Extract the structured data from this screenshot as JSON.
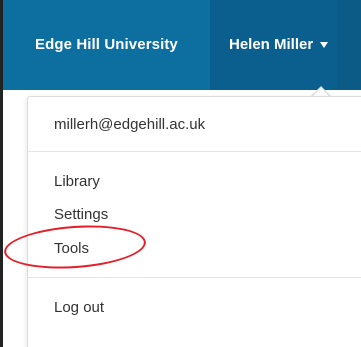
{
  "header": {
    "brand": "Edge Hill University",
    "user_name": "Helen Miller"
  },
  "menu": {
    "email": "millerh@edgehill.ac.uk",
    "items": [
      {
        "label": "Library"
      },
      {
        "label": "Settings"
      },
      {
        "label": "Tools"
      }
    ],
    "logout_label": "Log out"
  },
  "colors": {
    "header_bg": "#0d6ea0",
    "user_tab_bg": "#0a5f8e",
    "highlight": "#e3202a"
  },
  "icons": {
    "user_dropdown": "caret-down-icon"
  }
}
